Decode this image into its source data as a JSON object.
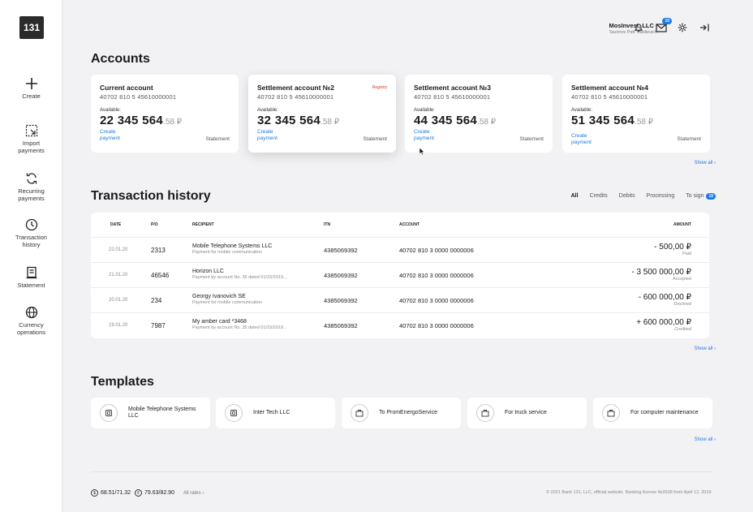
{
  "brand": {
    "logo": "131"
  },
  "sidebar": {
    "items": [
      {
        "label": "Create",
        "icon": "plus-icon"
      },
      {
        "label": "Import\npayments",
        "icon": "import-icon"
      },
      {
        "label": "Recurring\npayments",
        "icon": "recurring-icon"
      },
      {
        "label": "Transaction\nhistory",
        "icon": "clock-icon"
      },
      {
        "label": "Statement",
        "icon": "statement-icon"
      },
      {
        "label": "Currency\noperations",
        "icon": "globe-icon"
      }
    ]
  },
  "header": {
    "company": "MosInvest, LLC",
    "user": "Taurinov Petr Vasilievich",
    "mail_badge": "10",
    "icons": [
      "bell-icon",
      "mail-icon",
      "gear-icon",
      "logout-icon"
    ]
  },
  "accounts": {
    "title": "Accounts",
    "show_all": "Show all",
    "cards": [
      {
        "title": "Current account",
        "number": "40702 810 5 45610000001",
        "available_label": "Available:",
        "amount": "22 345 564",
        "fraction": ".58 ₽",
        "create": "Create payment",
        "statement": "Statement",
        "registry": ""
      },
      {
        "title": "Settlement account №2",
        "number": "40702 810 5 45610000001",
        "available_label": "Available:",
        "amount": "32 345 564",
        "fraction": ".58 ₽",
        "create": "Create payment",
        "statement": "Statement",
        "registry": "Registry"
      },
      {
        "title": "Settlement account №3",
        "number": "40702 810 5 45610000001",
        "available_label": "Available:",
        "amount": "44 345 564",
        "fraction": ".58 ₽",
        "create": "Create payment",
        "statement": "Statement",
        "registry": ""
      },
      {
        "title": "Settlement account №4",
        "number": "40702 810 5 45610000001",
        "available_label": "Available:",
        "amount": "51 345 564",
        "fraction": ".58 ₽",
        "create": "Create payment",
        "statement": "Statement",
        "registry": ""
      }
    ]
  },
  "history": {
    "title": "Transaction history",
    "filters": [
      "All",
      "Credits",
      "Debits",
      "Processing",
      "To sign"
    ],
    "sign_badge": "10",
    "show_all": "Show all",
    "columns": [
      "DATE",
      "P/O",
      "RECIPIENT",
      "ITN",
      "ACCOUNT",
      "AMOUNT"
    ],
    "rows": [
      {
        "date": "22.01.20",
        "po": "2313",
        "recipient": "Mobile Telephone Systems LLC",
        "desc": "Payment for mobile communication",
        "itn": "4385069392",
        "account": "40702 810 3 0000 0000006",
        "amount": "- 500,00 ₽",
        "status": "Paid"
      },
      {
        "date": "21.01.20",
        "po": "46546",
        "recipient": "Horizon LLC",
        "desc": "Payment by account No. 35 dated 01/15/2019...",
        "itn": "4385069392",
        "account": "40702 810 3 0000 0000006",
        "amount": "- 3 500 000,00 ₽",
        "status": "Accepted"
      },
      {
        "date": "20.01.20",
        "po": "234",
        "recipient": "Georgy Ivanovich SE",
        "desc": "Payment for mobile communication",
        "itn": "4385069392",
        "account": "40702 810 3 0000 0000006",
        "amount": "- 600 000,00 ₽",
        "status": "Declined"
      },
      {
        "date": "19.01.20",
        "po": "7987",
        "recipient": "My amber card *3468",
        "desc": "Payment by account No. 35 dated 01/15/2019...",
        "itn": "4385069392",
        "account": "40702 810 3 0000 0000006",
        "amount": "+ 600 000,00 ₽",
        "status": "Credited"
      }
    ]
  },
  "templates": {
    "title": "Templates",
    "show_all": "Show all",
    "items": [
      {
        "label": "Mobile Telephone Systems LLC",
        "icon": "phone-icon"
      },
      {
        "label": "Inter Tech LLC",
        "icon": "phone-icon"
      },
      {
        "label": "To PromEnergoService",
        "icon": "briefcase-icon"
      },
      {
        "label": "For truck service",
        "icon": "briefcase-icon"
      },
      {
        "label": "For computer maintenance",
        "icon": "briefcase-icon"
      }
    ]
  },
  "footer": {
    "usd": "68.51/71.32",
    "eur": "79.63/82.90",
    "all_rates": "All rates",
    "copyright": "© 2021 Bank 131, LLC, official website. Banking license №3538 from April 12, 2019."
  }
}
